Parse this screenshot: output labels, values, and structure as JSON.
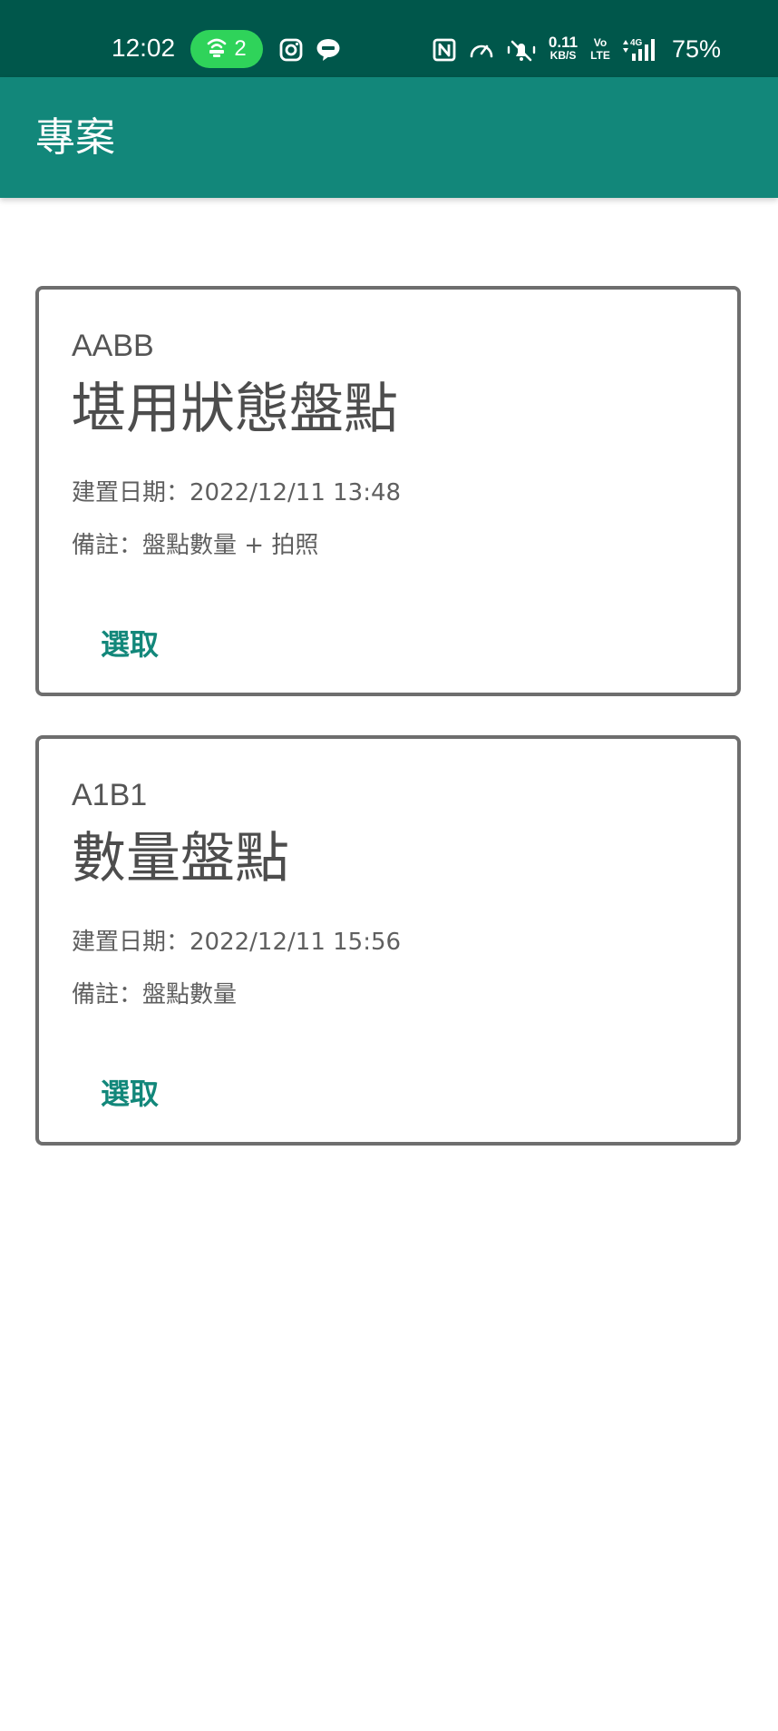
{
  "status_bar": {
    "time": "12:02",
    "hotspot_count": "2",
    "net_speed_value": "0.11",
    "net_speed_unit": "KB/S",
    "volte_top": "Vo",
    "volte_bottom": "LTE",
    "network_type": "4G",
    "battery": "75%",
    "icons": [
      "hotspot-icon",
      "instagram-icon",
      "line-icon",
      "nfc-icon",
      "speedometer-icon",
      "bell-off-icon",
      "signal-icon"
    ]
  },
  "app_bar": {
    "title": "專案"
  },
  "colors": {
    "status_bar": "#00574b",
    "app_bar": "#12877a",
    "accent": "#12877a",
    "hotspot_pill": "#2fd35a",
    "card_border": "#6e6e6e"
  },
  "projects": [
    {
      "code": "AABB",
      "name": "堪用狀態盤點",
      "created": "建置日期：2022/12/11 13:48",
      "note": "備註：盤點數量 + 拍照",
      "select_label": "選取"
    },
    {
      "code": "A1B1",
      "name": "數量盤點",
      "created": "建置日期：2022/12/11 15:56",
      "note": "備註：盤點數量",
      "select_label": "選取"
    }
  ]
}
